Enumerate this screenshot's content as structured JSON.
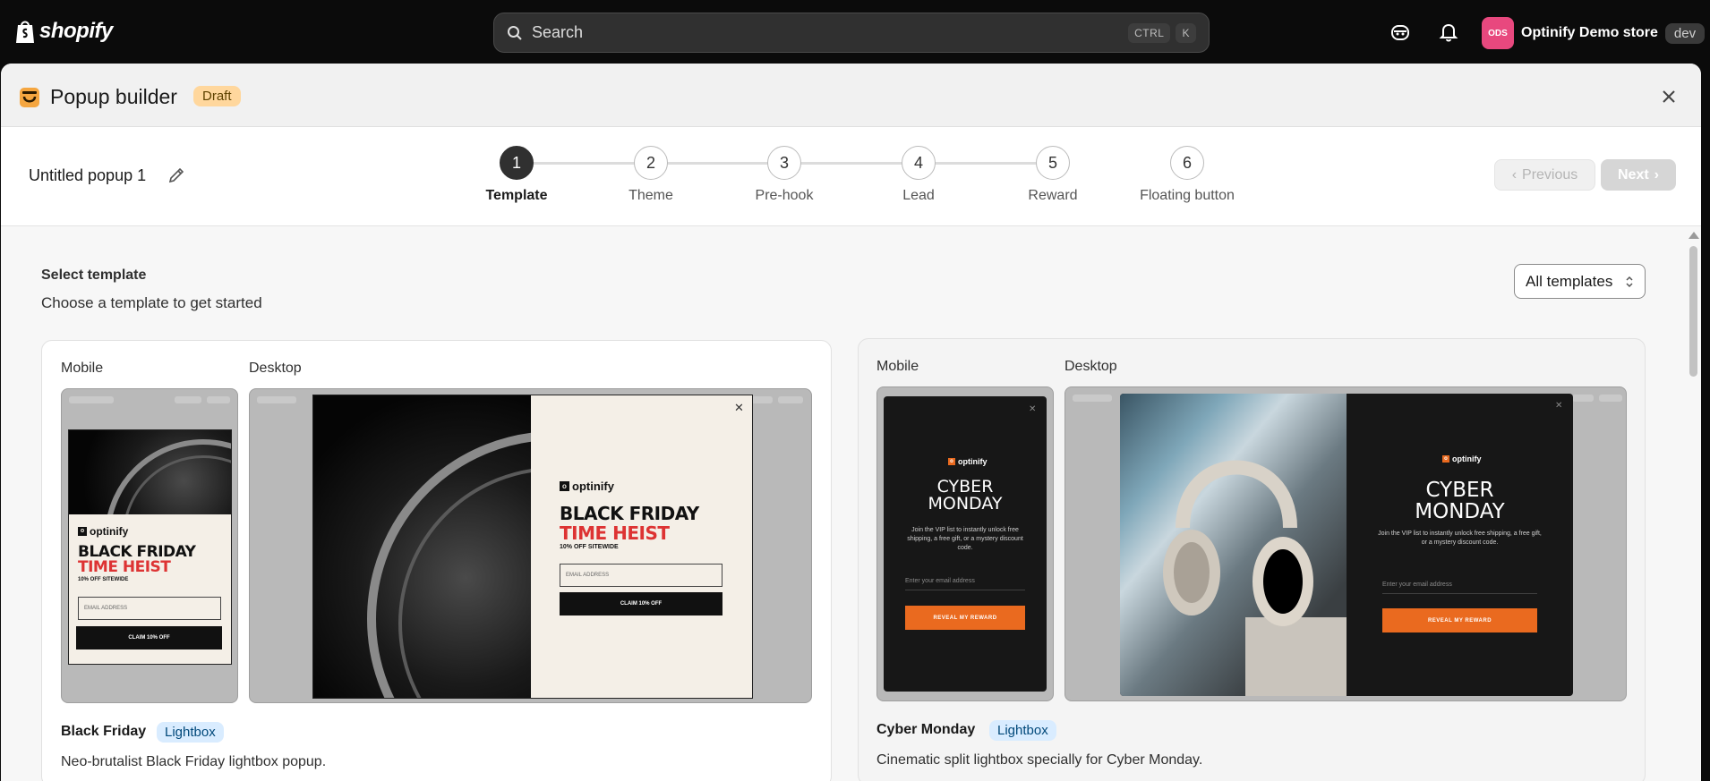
{
  "topbar": {
    "logo_text": "shopify",
    "search_placeholder": "Search",
    "shortcut_ctrl": "CTRL",
    "shortcut_key": "K",
    "store_initials": "ODS",
    "store_name": "Optinify Demo store",
    "store_env": "dev"
  },
  "modal": {
    "title": "Popup builder",
    "status": "Draft",
    "popup_name": "Untitled popup 1",
    "steps": [
      {
        "number": "1",
        "label": "Template"
      },
      {
        "number": "2",
        "label": "Theme"
      },
      {
        "number": "3",
        "label": "Pre-hook"
      },
      {
        "number": "4",
        "label": "Lead"
      },
      {
        "number": "5",
        "label": "Reward"
      },
      {
        "number": "6",
        "label": "Floating button"
      }
    ],
    "prev_label": "Previous",
    "next_label": "Next"
  },
  "content": {
    "title": "Select template",
    "subtitle": "Choose a template to get started",
    "filter_label": "All templates"
  },
  "templates": [
    {
      "mobile_label": "Mobile",
      "desktop_label": "Desktop",
      "name": "Black Friday",
      "type": "Lightbox",
      "description": "Neo-brutalist Black Friday lightbox popup.",
      "popup": {
        "brand": "optinify",
        "line1": "BLACK FRIDAY",
        "line2": "TIME HEIST",
        "offer": "10% OFF SITEWIDE",
        "input_placeholder": "EMAIL ADDRESS",
        "button": "CLAIM 10% OFF"
      }
    },
    {
      "mobile_label": "Mobile",
      "desktop_label": "Desktop",
      "name": "Cyber Monday",
      "type": "Lightbox",
      "description": "Cinematic split lightbox specially for Cyber Monday.",
      "popup": {
        "brand": "optinify",
        "line1": "CYBER",
        "line2": "MONDAY",
        "body": "Join the VIP list to instantly unlock free shipping, a free gift, or a mystery discount code.",
        "input_placeholder": "Enter your email address",
        "button": "REVEAL MY REWARD"
      }
    }
  ]
}
